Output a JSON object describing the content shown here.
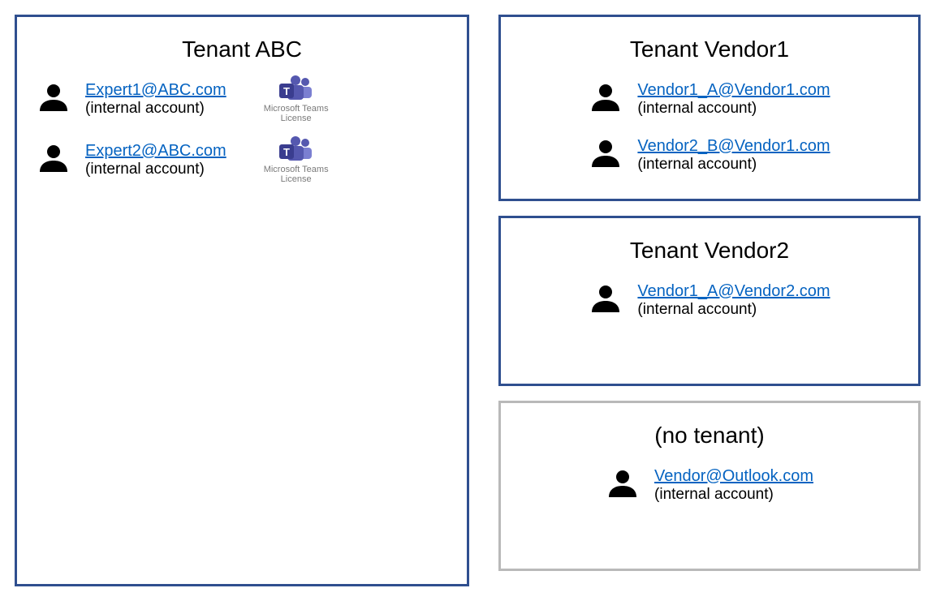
{
  "left": {
    "title": "Tenant ABC",
    "users": [
      {
        "email": "Expert1@ABC.com",
        "sub": "(internal account)",
        "license_line1": "Microsoft Teams",
        "license_line2": "License"
      },
      {
        "email": "Expert2@ABC.com",
        "sub": "(internal account)",
        "license_line1": "Microsoft Teams",
        "license_line2": "License"
      }
    ]
  },
  "right": [
    {
      "title": "Tenant Vendor1",
      "grey": false,
      "users": [
        {
          "email": "Vendor1_A@Vendor1.com",
          "sub": "(internal account)"
        },
        {
          "email": "Vendor2_B@Vendor1.com",
          "sub": "(internal account)"
        }
      ]
    },
    {
      "title": "Tenant Vendor2",
      "grey": false,
      "users": [
        {
          "email": "Vendor1_A@Vendor2.com",
          "sub": "(internal account)"
        }
      ]
    },
    {
      "title": "(no tenant)",
      "grey": true,
      "users": [
        {
          "email": "Vendor@Outlook.com",
          "sub": "(internal account)"
        }
      ]
    }
  ]
}
